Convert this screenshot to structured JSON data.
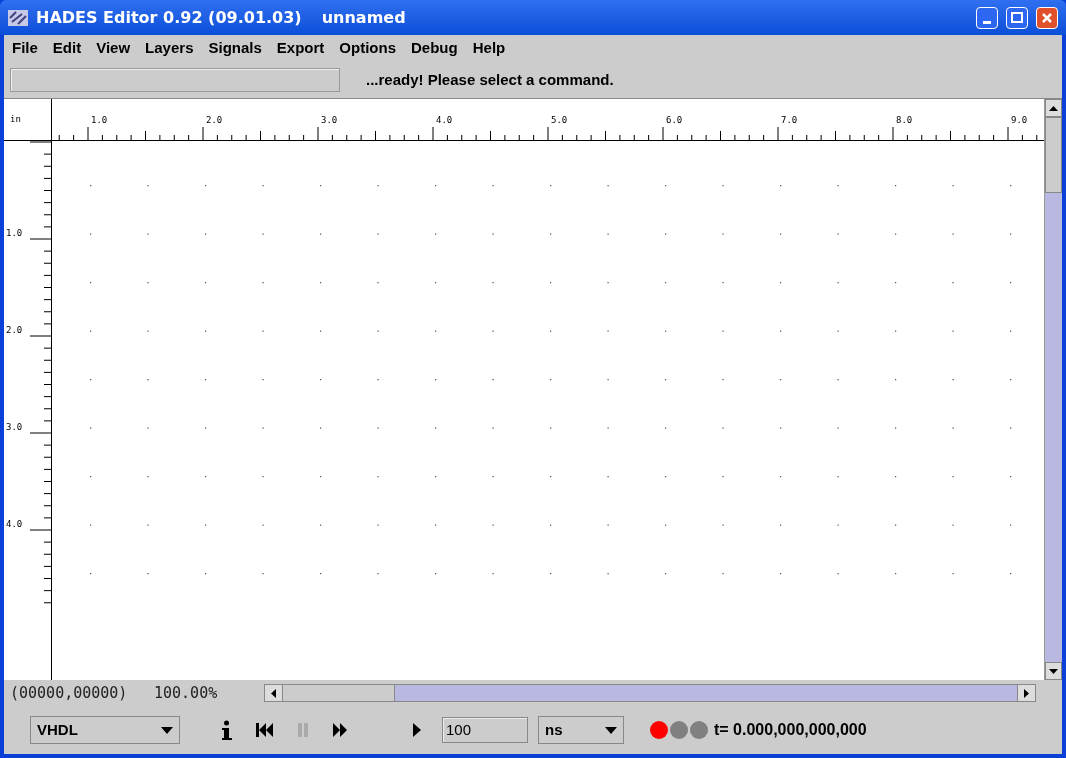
{
  "window": {
    "title": "HADES Editor 0.92 (09.01.03)",
    "document": "unnamed"
  },
  "menu": [
    "File",
    "Edit",
    "View",
    "Layers",
    "Signals",
    "Export",
    "Options",
    "Debug",
    "Help"
  ],
  "status": {
    "message": "...ready! Please select a command."
  },
  "ruler": {
    "unit": "in",
    "x_labels": [
      "1.0",
      "2.0",
      "3.0",
      "4.0",
      "5.0",
      "6.0",
      "7.0",
      "8.0",
      "9.0"
    ],
    "y_labels": [
      "1.0",
      "2.0",
      "3.0",
      "4.0"
    ]
  },
  "info": {
    "coordinates": "(00000,00000)",
    "zoom": "100.00%"
  },
  "toolbar": {
    "language": "VHDL",
    "buttons": [
      {
        "kind": "info",
        "disabled": false
      },
      {
        "kind": "rewind",
        "disabled": false
      },
      {
        "kind": "pause",
        "disabled": true
      },
      {
        "kind": "fast_forward",
        "disabled": false
      },
      {
        "kind": "run",
        "disabled": false
      }
    ],
    "run_time": "100",
    "time_unit": "ns",
    "indicators": [
      {
        "color": "#ff0000"
      },
      {
        "color": "#808080"
      },
      {
        "color": "#808080"
      }
    ],
    "time": "t= 0.000,000,000,000"
  }
}
